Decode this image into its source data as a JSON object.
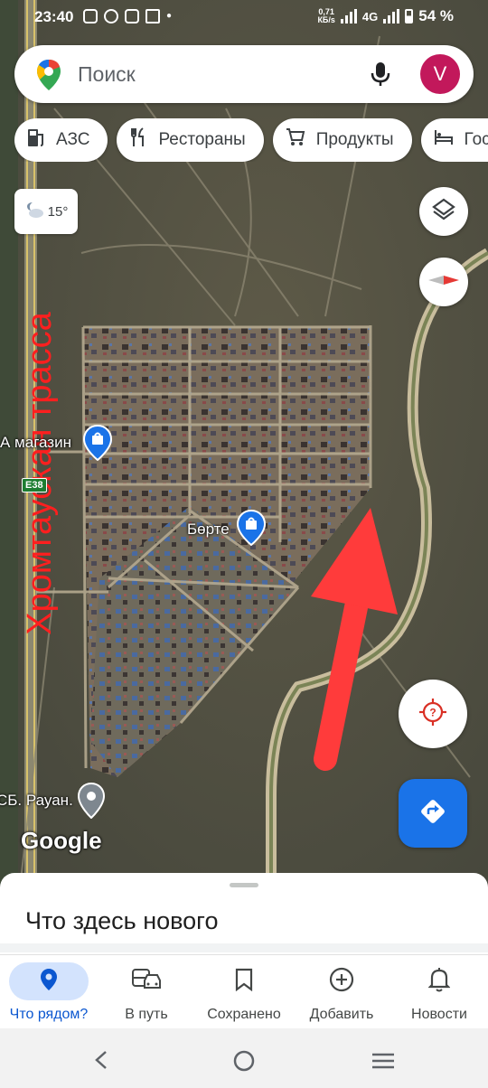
{
  "status_bar": {
    "time": "23:40",
    "net_speed_value": "0,71",
    "net_speed_unit": "КБ/s",
    "network": "4G",
    "battery": "54 %"
  },
  "search": {
    "placeholder": "Поиск",
    "avatar_letter": "V"
  },
  "chips": [
    {
      "label": "АЗС",
      "icon": "gas-station-icon"
    },
    {
      "label": "Рестораны",
      "icon": "restaurant-icon"
    },
    {
      "label": "Продукты",
      "icon": "cart-icon"
    },
    {
      "label": "Гостиницы",
      "icon": "hotel-icon"
    }
  ],
  "weather": {
    "temp": "15°",
    "icon": "partly-cloudy-night-icon"
  },
  "map": {
    "labels": {
      "shop": "А магазин",
      "place": "Бөрте",
      "bus_stop": "СБ. Рауан.",
      "road_shield": "E38",
      "logo": "Google"
    },
    "annotation": {
      "text": "Хромтауская трасса",
      "color": "#ff1f1f",
      "arrow_color": "#ff3b3b"
    }
  },
  "sheet": {
    "title": "Что здесь нового"
  },
  "nav": [
    {
      "label": "Что рядом?",
      "icon": "explore-pin-icon",
      "active": true
    },
    {
      "label": "В путь",
      "icon": "commute-icon",
      "active": false
    },
    {
      "label": "Сохранено",
      "icon": "bookmark-icon",
      "active": false
    },
    {
      "label": "Добавить",
      "icon": "add-circle-icon",
      "active": false
    },
    {
      "label": "Новости",
      "icon": "bell-icon",
      "active": false
    }
  ],
  "colors": {
    "accent": "#1a73e8",
    "active_tab_bg": "#d3e3fd",
    "avatar_bg": "#c2185b"
  }
}
